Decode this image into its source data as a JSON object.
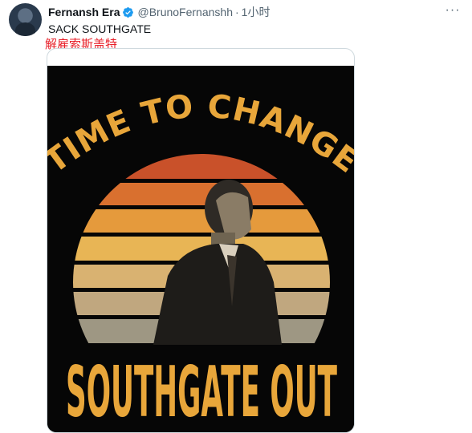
{
  "tweet": {
    "display_name": "Fernansh Era",
    "handle": "@BrunoFernanshh",
    "separator": "·",
    "time": "1小时",
    "more_label": "···",
    "text": "SACK SOUTHGATE",
    "translation": "解雇索斯盖特"
  },
  "media": {
    "top_text": "TIME TO CHANGE",
    "bottom_text": "SOUTHGATE OUT"
  },
  "colors": {
    "verified": "#1d9bf0",
    "translation": "#e8202a",
    "poster_text": "#e8a63a",
    "sun_stripes": [
      "#c9512a",
      "#d9702f",
      "#e59a3c",
      "#e8b555",
      "#d9b271",
      "#c0a77f",
      "#9e9783"
    ]
  },
  "icons": {
    "verified": "verified-badge-icon",
    "more": "more-options-icon",
    "avatar": "user-avatar"
  }
}
